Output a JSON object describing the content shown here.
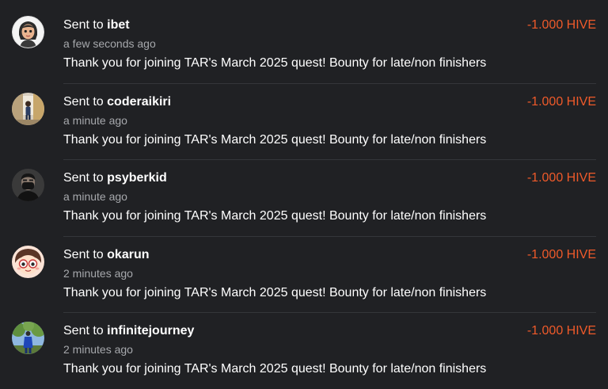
{
  "colors": {
    "background": "#202124",
    "text": "#ffffff",
    "muted": "#a6a8ac",
    "amount_negative": "#ef5a2a",
    "divider": "#34363a"
  },
  "transfers": [
    {
      "prefix": "Sent to",
      "username": "ibet",
      "time": "a few seconds ago",
      "memo": "Thank you for joining TAR's March 2025 quest! Bounty for late/non finishers",
      "amount": "-1.000 HIVE",
      "avatar_icon": "cartoon-girl-avatar-icon"
    },
    {
      "prefix": "Sent to",
      "username": "coderaikiri",
      "time": "a minute ago",
      "memo": "Thank you for joining TAR's March 2025 quest! Bounty for late/non finishers",
      "amount": "-1.000 HIVE",
      "avatar_icon": "person-photo-avatar-icon"
    },
    {
      "prefix": "Sent to",
      "username": "psyberkid",
      "time": "a minute ago",
      "memo": "Thank you for joining TAR's March 2025 quest! Bounty for late/non finishers",
      "amount": "-1.000 HIVE",
      "avatar_icon": "masked-person-avatar-icon"
    },
    {
      "prefix": "Sent to",
      "username": "okarun",
      "time": "2 minutes ago",
      "memo": "Thank you for joining TAR's March 2025 quest! Bounty for late/non finishers",
      "amount": "-1.000 HIVE",
      "avatar_icon": "anime-character-avatar-icon"
    },
    {
      "prefix": "Sent to",
      "username": "infinitejourney",
      "time": "2 minutes ago",
      "memo": "Thank you for joining TAR's March 2025 quest! Bounty for late/non finishers",
      "amount": "-1.000 HIVE",
      "avatar_icon": "person-outdoors-avatar-icon"
    }
  ]
}
